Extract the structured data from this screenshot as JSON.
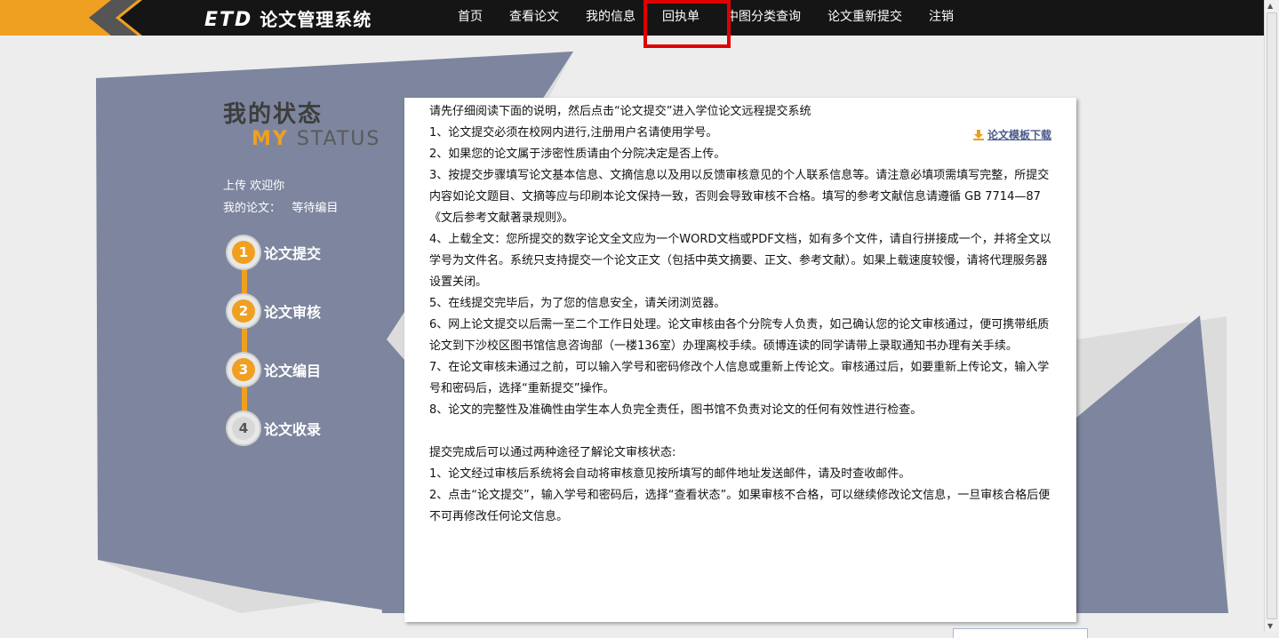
{
  "header": {
    "logo_etd": "ETD",
    "logo_text": "论文管理系统",
    "nav": [
      "首页",
      "查看论文",
      "我的信息",
      "回执单",
      "中图分类查询",
      "论文重新提交",
      "注销"
    ]
  },
  "sidebar": {
    "title_cn": "我的状态",
    "title_en_my": "MY",
    "title_en_status": "STATUS",
    "welcome": "上传 欢迎你",
    "my_paper_label": "我的论文：",
    "my_paper_status": "等待编目",
    "steps": [
      {
        "num": "1",
        "label": "论文提交"
      },
      {
        "num": "2",
        "label": "论文审核"
      },
      {
        "num": "3",
        "label": "论文编目"
      },
      {
        "num": "4",
        "label": "论文收录"
      }
    ]
  },
  "content": {
    "download_label": "论文模板下载",
    "paragraphs": [
      "请先仔细阅读下面的说明，然后点击“论文提交”进入学位论文远程提交系统",
      "1、论文提交必须在校网内进行,注册用户名请使用学号。",
      "2、如果您的论文属于涉密性质请由个分院决定是否上传。",
      "3、按提交步骤填写论文基本信息、文摘信息以及用以反馈审核意见的个人联系信息等。请注意必填项需填写完整，所提交内容如论文题目、文摘等应与印刷本论文保持一致，否则会导致审核不合格。填写的参考文献信息请遵循 GB 7714—87《文后参考文献著录规则》。",
      "4、上载全文：您所提交的数字论文全文应为一个WORD文档或PDF文档，如有多个文件，请自行拼接成一个，并将全文以学号为文件名。系统只支持提交一个论文正文（包括中英文摘要、正文、参考文献）。如果上载速度较慢，请将代理服务器设置关闭。",
      "5、在线提交完毕后，为了您的信息安全，请关闭浏览器。",
      "6、网上论文提交以后需一至二个工作日处理。论文审核由各个分院专人负责，如己确认您的论文审核通过，便可携带纸质论文到下沙校区图书馆信息咨询部（一楼136室）办理离校手续。硕博连读的同学请带上录取通知书办理有关手续。",
      "7、在论文审核未通过之前，可以输入学号和密码修改个人信息或重新上传论文。审核通过后，如要重新上传论文，输入学号和密码后，选择“重新提交”操作。",
      "8、论文的完整性及准确性由学生本人负完全责任，图书馆不负责对论文的任何有效性进行检查。"
    ],
    "paragraphs2": [
      "提交完成后可以通过两种途径了解论文审核状态:",
      "1、论文经过审核后系统将会自动将审核意见按所填写的邮件地址发送邮件，请及时查收邮件。",
      "2、点击“论文提交”，输入学号和密码后，选择“查看状态”。如果审核不合格，可以继续修改论文信息，一旦审核合格后便不可再修改任何论文信息。"
    ]
  }
}
